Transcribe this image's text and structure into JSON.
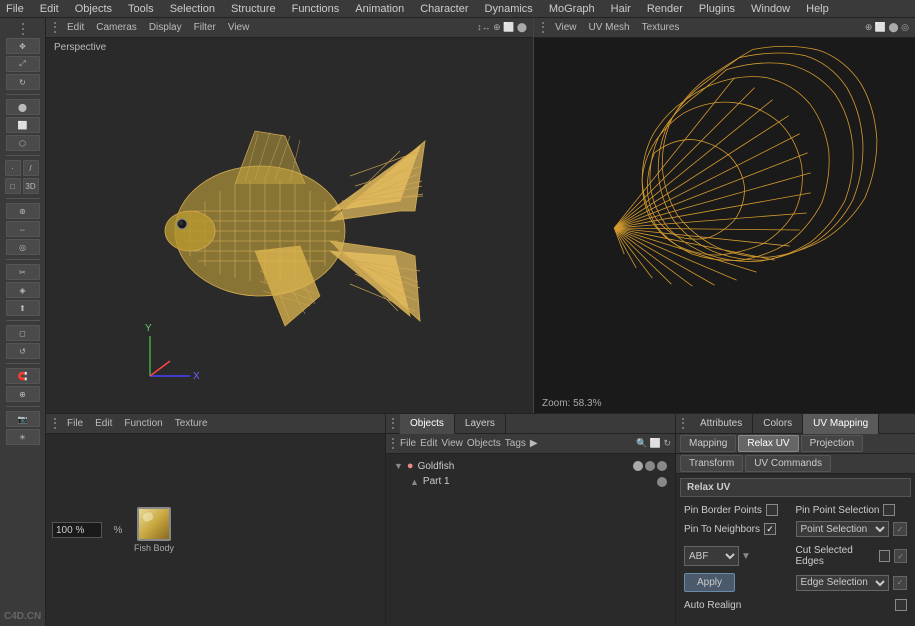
{
  "menubar": {
    "items": [
      "File",
      "Edit",
      "Objects",
      "Tools",
      "Selection",
      "Structure",
      "Functions",
      "Animation",
      "Character",
      "Dynamics",
      "MoGraph",
      "Hair",
      "Render",
      "Plugins",
      "Window",
      "Help"
    ]
  },
  "left_viewport": {
    "toolbar_items": [
      "Edit",
      "Cameras",
      "Display",
      "Filter",
      "View"
    ],
    "perspective_label": "Perspective",
    "move_icons": [
      "↕↔",
      "⊕",
      "⬜",
      "⬤"
    ]
  },
  "right_viewport": {
    "toolbar_items": [
      "View",
      "UV Mesh",
      "Textures"
    ],
    "zoom_label": "Zoom: 58.3%"
  },
  "bottom_left": {
    "toolbar_items": [
      "File",
      "Edit",
      "Function",
      "Texture"
    ],
    "percentage": "100 %",
    "material_label": "Fish Body"
  },
  "objects_panel": {
    "tabs": [
      "Objects",
      "Layers"
    ],
    "toolbar_items": [
      "File",
      "Edit",
      "View",
      "Objects",
      "Tags",
      "▶"
    ],
    "items": [
      {
        "name": "Goldfish",
        "type": "object",
        "indent": 0
      },
      {
        "name": "Part 1",
        "type": "part",
        "indent": 1
      }
    ]
  },
  "attributes_panel": {
    "tabs": [
      "Attributes",
      "Colors",
      "UV Mapping"
    ],
    "active_tab": "UV Mapping",
    "uv_subtabs": [
      "Mapping",
      "Relax UV",
      "Projection"
    ],
    "transform_subtabs": [
      "Transform",
      "UV Commands"
    ],
    "active_subtab": "Relax UV",
    "relax_uv": {
      "section_header": "Relax UV",
      "params": {
        "pin_border_points_label": "Pin Border Points",
        "pin_border_points_checked": false,
        "pin_point_selection_label": "Pin Point Selection",
        "pin_point_selection_checked": false,
        "pin_to_neighbors_label": "Pin To Neighbors",
        "pin_to_neighbors_checked": true,
        "point_selection_label": "Point Selection",
        "point_selection_value": "Point Selection",
        "abf_label": "ABF",
        "apply_label": "Apply",
        "cut_selected_edges_label": "Cut Selected Edges",
        "cut_selected_edges_checked": false,
        "edge_selection_label": "Edge Selection",
        "edge_selection_value": "Edge Selection",
        "auto_realign_label": "Auto Realign",
        "auto_realign_checked": false
      }
    }
  },
  "watermark": "C4D.CN",
  "icons": {
    "arrow": "▶",
    "triangle": "▲",
    "dot": "●",
    "check": "✓",
    "plus": "+",
    "minus": "−",
    "gear": "⚙",
    "folder": "📁",
    "sphere": "◉",
    "move": "✥",
    "rotate": "↻",
    "scale": "⤢"
  }
}
